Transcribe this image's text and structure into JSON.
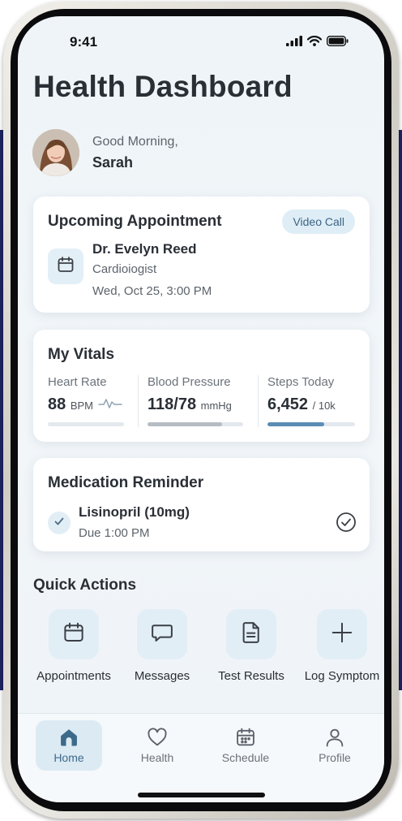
{
  "status_bar": {
    "time": "9:41"
  },
  "header": {
    "title": "Health Dashboard"
  },
  "greeting": {
    "line1": "Good Morning,",
    "name": "Sarah"
  },
  "appointment": {
    "title": "Upcoming Appointment",
    "video_call_label": "Video Call",
    "doctor": "Dr. Evelyn Reed",
    "specialty": "Cardioiogist",
    "datetime": "Wed, Oct 25, 3:00 PM",
    "icon": "calendar-icon"
  },
  "vitals": {
    "title": "My Vitals",
    "items": [
      {
        "label": "Heart Rate",
        "value": "88",
        "unit": "BPM",
        "progress": 1.0,
        "bar_color": "#e4e9ee"
      },
      {
        "label": "Blood Pressure",
        "value": "118/78",
        "unit": "mmHg",
        "progress": 0.78,
        "bar_color": "#b6bcc3"
      },
      {
        "label": "Steps Today",
        "value": "6,452",
        "unit": "/ 10k",
        "progress": 0.65,
        "bar_color": "#5b8db4"
      }
    ]
  },
  "medication": {
    "title": "Medication Reminder",
    "name": "Lisinopril (10mg)",
    "due": "Due 1:00 PM"
  },
  "quick_actions": {
    "title": "Quick Actions",
    "items": [
      {
        "label": "Appointments",
        "icon": "calendar-icon"
      },
      {
        "label": "Messages",
        "icon": "message-icon"
      },
      {
        "label": "Test Results",
        "icon": "document-icon"
      },
      {
        "label": "Log Symptom",
        "icon": "plus-icon"
      }
    ]
  },
  "tabbar": {
    "items": [
      {
        "label": "Home",
        "icon": "home-icon",
        "active": true
      },
      {
        "label": "Health",
        "icon": "heart-icon",
        "active": false
      },
      {
        "label": "Schedule",
        "icon": "calendar-icon",
        "active": false
      },
      {
        "label": "Profile",
        "icon": "person-icon",
        "active": false
      }
    ]
  },
  "colors": {
    "accent": "#3e6a8a",
    "background_stripe": "#1d2463"
  }
}
